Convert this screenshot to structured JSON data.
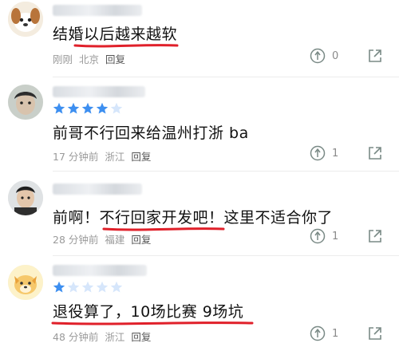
{
  "comments": [
    {
      "text": "结婚以后越来越软",
      "time": "刚刚",
      "location": "北京",
      "reply_label": "回复",
      "likes": "0",
      "rating": null,
      "avatar_icon": "dog-avatar-icon"
    },
    {
      "text": "前哥不行回来给温州打浙 ba",
      "time": "17 分钟前",
      "location": "浙江",
      "reply_label": "回复",
      "likes": "1",
      "rating": 4,
      "rating_max": 5,
      "avatar_icon": "man-avatar-icon"
    },
    {
      "text": "前啊！不行回家开发吧！这里不适合你了",
      "time": "28 分钟前",
      "location": "福建",
      "reply_label": "回复",
      "likes": "1",
      "rating": null,
      "avatar_icon": "man-avatar-icon"
    },
    {
      "text": "退役算了，10场比赛 9场坑",
      "time": "48 分钟前",
      "location": "浙江",
      "reply_label": "回复",
      "likes": "1",
      "rating": 1,
      "rating_max": 5,
      "avatar_icon": "cartoon-dog-avatar-icon"
    }
  ],
  "colors": {
    "underline": "#e0202a",
    "star_active": "#3d8ff0",
    "star_inactive": "#d6e6fb",
    "meta_text": "#9a9a9a",
    "icon": "#8a8a8a"
  }
}
